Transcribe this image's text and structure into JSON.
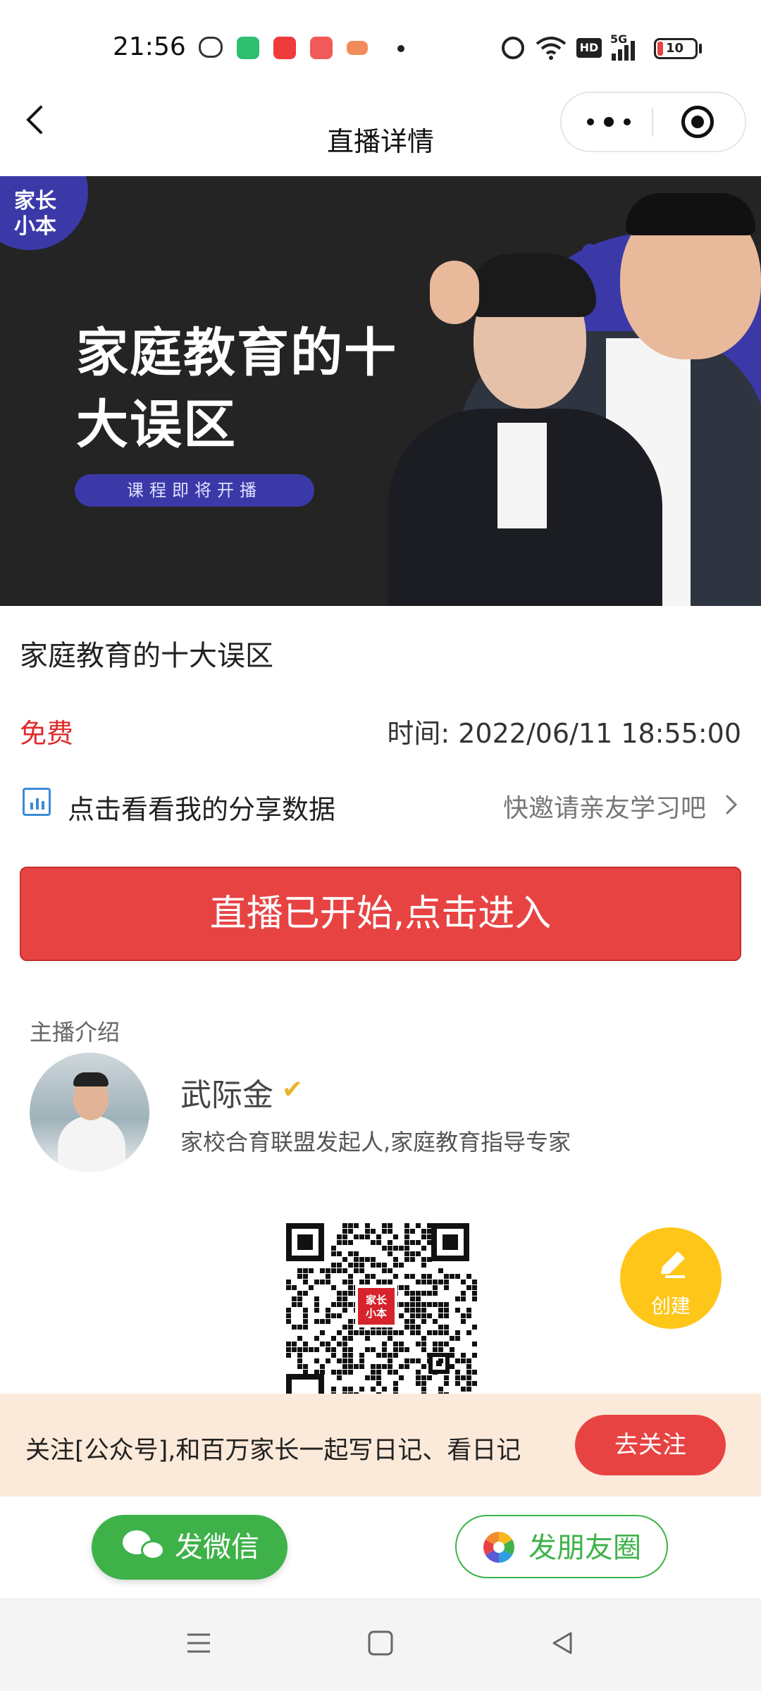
{
  "status_bar": {
    "time": "21:56",
    "network": "5G",
    "hd": "HD",
    "battery": "10"
  },
  "nav": {
    "title": "直播详情"
  },
  "banner": {
    "logo_text": "家长小本",
    "title_line1": "家庭教育的十",
    "title_line2": "大误区",
    "badge": "课程即将开播"
  },
  "course": {
    "title": "家庭教育的十大误区",
    "price": "免费",
    "time_label": "时间:",
    "time_value": "2022/06/11 18:55:00",
    "share_data": "点击看看我的分享数据",
    "invite": "快邀请亲友学习吧",
    "enter_button": "直播已开始,点击进入"
  },
  "host": {
    "section_label": "主播介绍",
    "name": "武际金",
    "description": "家校合育联盟发起人,家庭教育指导专家"
  },
  "qr": {
    "logo_text": "家长小本"
  },
  "fab": {
    "label": "创建"
  },
  "follow_bar": {
    "text": "关注[公众号],和百万家长一起写日记、看日记",
    "button": "去关注"
  },
  "share_bar": {
    "wechat": "发微信",
    "moments": "发朋友圈"
  },
  "colors": {
    "primary_red": "#e84343",
    "price_red": "#e02b2b",
    "wechat_green": "#3eb249",
    "banner_bg": "#242424",
    "banner_accent": "#3b39a8",
    "fab_yellow": "#ffc61a",
    "follow_bar_bg": "#fbe9d9"
  }
}
